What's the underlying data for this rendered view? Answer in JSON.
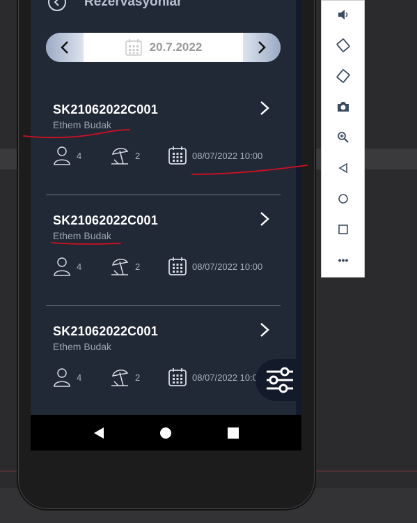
{
  "header": {
    "title": "Rezervasyonlar"
  },
  "date_picker": {
    "value": "20.7.2022"
  },
  "reservations": [
    {
      "code": "SK21062022C001",
      "name": "Ethem Budak",
      "adults": "4",
      "umbrellas": "2",
      "datetime": "08/07/2022 10:00"
    },
    {
      "code": "SK21062022C001",
      "name": "Ethem Budak",
      "adults": "4",
      "umbrellas": "2",
      "datetime": "08/07/2022 10:00"
    },
    {
      "code": "SK21062022C001",
      "name": "Ethem Budak",
      "adults": "4",
      "umbrellas": "2",
      "datetime": "08/07/2022 10:00"
    }
  ],
  "emulator_toolbar": {
    "items": [
      "volume-icon",
      "rotate-left-icon",
      "rotate-right-icon",
      "camera-icon",
      "zoom-icon",
      "back-icon",
      "home-icon",
      "overview-icon",
      "more-icon"
    ],
    "more_label": "•••"
  },
  "colors": {
    "screen_bg": "#212836",
    "annotation": "#d01020",
    "card_title": "#ffffff"
  }
}
